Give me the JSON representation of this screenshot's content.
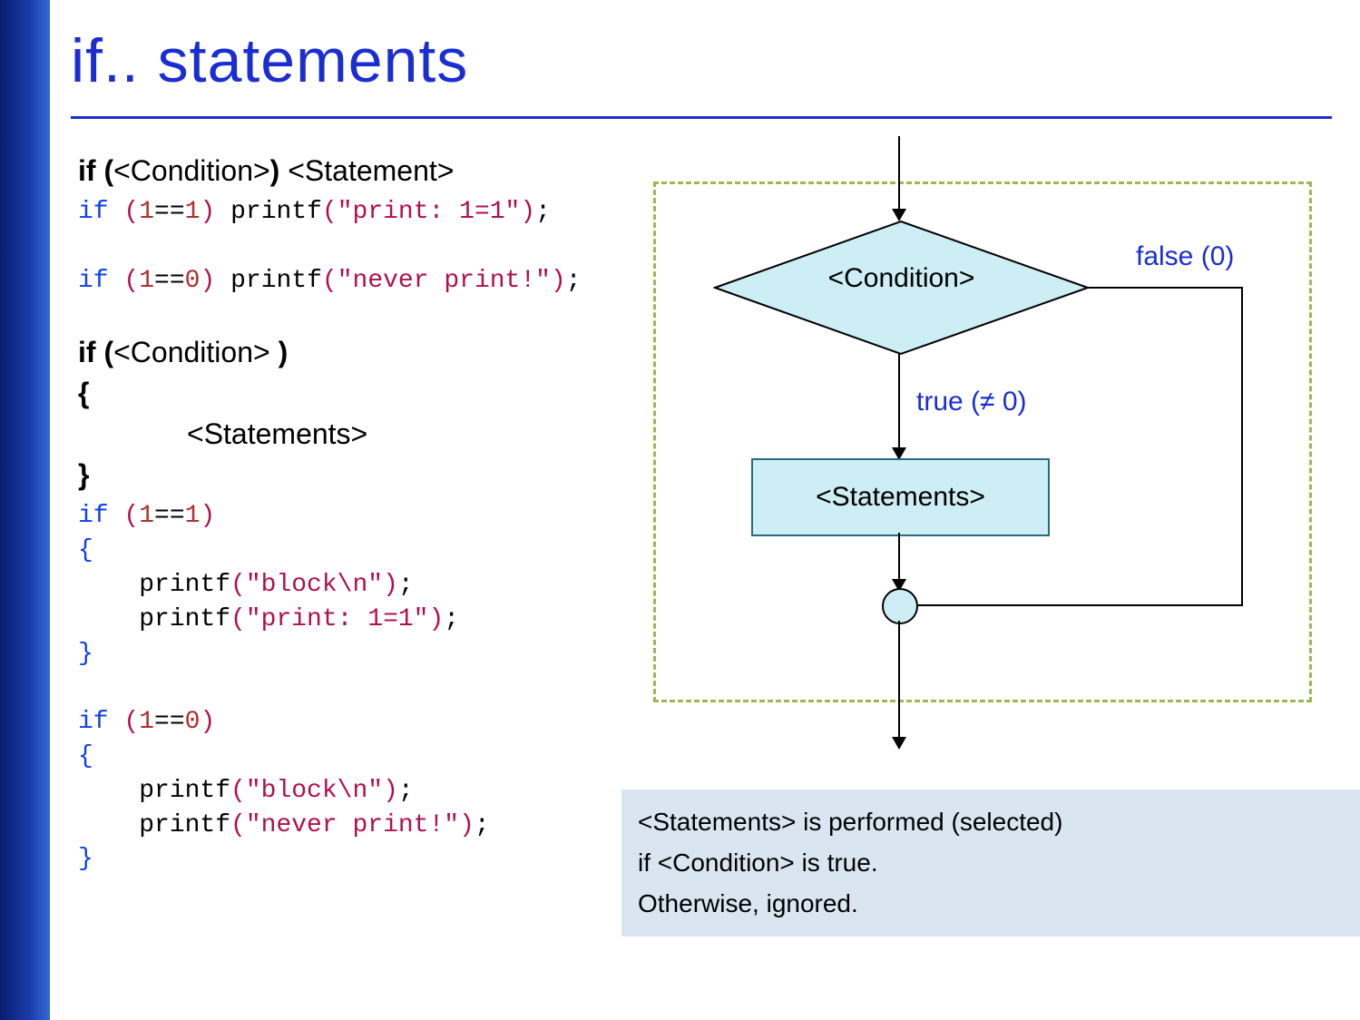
{
  "title": "if.. statements",
  "syntax": {
    "form1": {
      "prefix": "if (",
      "cond": "<Condition>",
      "mid": ") ",
      "stmt": "<Statement>"
    },
    "form2": {
      "prefix": "if (",
      "cond": "<Condition>",
      "mid": " )",
      "open": "{",
      "body": "<Statements>",
      "close": "}"
    }
  },
  "code": {
    "ex1_a": "if",
    "ex1_b": "(",
    "ex1_c": "1",
    "ex1_d": "==",
    "ex1_e": "1",
    "ex1_f": ")",
    "ex1_g": " printf",
    "ex1_h": "(",
    "ex1_i": "\"print: 1=1\"",
    "ex1_j": ")",
    "ex1_k": ";",
    "ex2_a": "if",
    "ex2_b": "(",
    "ex2_c": "1",
    "ex2_d": "==",
    "ex2_e": "0",
    "ex2_f": ")",
    "ex2_g": " printf",
    "ex2_h": "(",
    "ex2_i": "\"never print!\"",
    "ex2_j": ")",
    "ex2_k": ";",
    "ex3_l1": "if",
    "ex3_l1b": "(",
    "ex3_l1c": "1",
    "ex3_l1d": "==",
    "ex3_l1e": "1",
    "ex3_l1f": ")",
    "ex3_l2": "{",
    "ex3_l3a": "    printf",
    "ex3_l3b": "(",
    "ex3_l3c": "\"block\\n\"",
    "ex3_l3d": ")",
    "ex3_l3e": ";",
    "ex3_l4a": "    printf",
    "ex3_l4b": "(",
    "ex3_l4c": "\"print: 1=1\"",
    "ex3_l4d": ")",
    "ex3_l4e": ";",
    "ex3_l5": "}",
    "ex4_l1": "if",
    "ex4_l1b": "(",
    "ex4_l1c": "1",
    "ex4_l1d": "==",
    "ex4_l1e": "0",
    "ex4_l1f": ")",
    "ex4_l2": "{",
    "ex4_l3a": "    printf",
    "ex4_l3b": "(",
    "ex4_l3c": "\"block\\n\"",
    "ex4_l3d": ")",
    "ex4_l3e": ";",
    "ex4_l4a": "    printf",
    "ex4_l4b": "(",
    "ex4_l4c": "\"never print!\"",
    "ex4_l4d": ")",
    "ex4_l4e": ";",
    "ex4_l5": "}"
  },
  "flow": {
    "condition": "<Condition>",
    "true_label": "true (≠ 0)",
    "false_label": "false (0)",
    "statements": "<Statements>"
  },
  "explain": {
    "l1": "<Statements> is performed (selected)",
    "l2": "if <Condition> is true.",
    "l3": "Otherwise, ignored."
  }
}
